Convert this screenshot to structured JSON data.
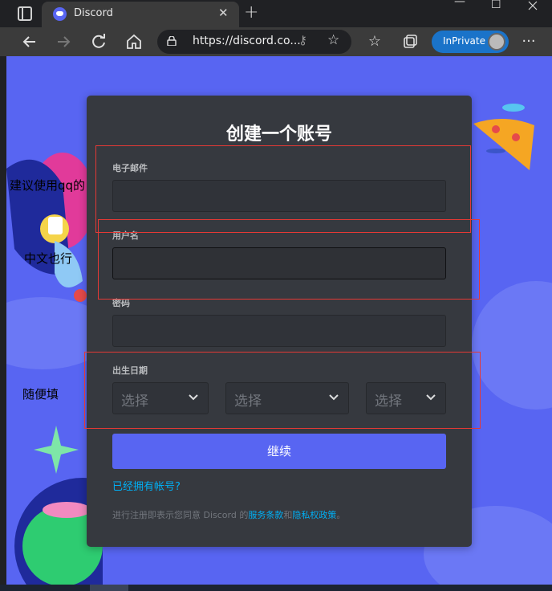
{
  "browser": {
    "tab_title": "Discord",
    "tab_close": "✕",
    "new_tab": "+",
    "url": "https://discord.co...",
    "inprivate_label": "InPrivate",
    "more_icon": "···",
    "win_min": "—",
    "win_max": "☐"
  },
  "form": {
    "title": "创建一个账号",
    "email_label": "电子邮件",
    "username_label": "用户名",
    "password_label": "密码",
    "dob_label": "出生日期",
    "dob_month_placeholder": "选择",
    "dob_day_placeholder": "选择",
    "dob_year_placeholder": "选择",
    "continue_label": "继续",
    "login_link": "已经拥有帐号?",
    "tos_prefix": "进行注册即表示您同意 Discord 的",
    "tos_terms": "服务条款",
    "tos_and": "和",
    "tos_privacy": "隐私权政策",
    "tos_suffix": "。"
  },
  "annotations": {
    "note1": "建议使用qq的",
    "note2": "中文也行",
    "note3": "随便填",
    "box_color": "#e53935"
  },
  "colors": {
    "page_bg": "#5865f2",
    "card_bg": "#36393f",
    "button": "#5865f2",
    "link": "#00aff4"
  }
}
